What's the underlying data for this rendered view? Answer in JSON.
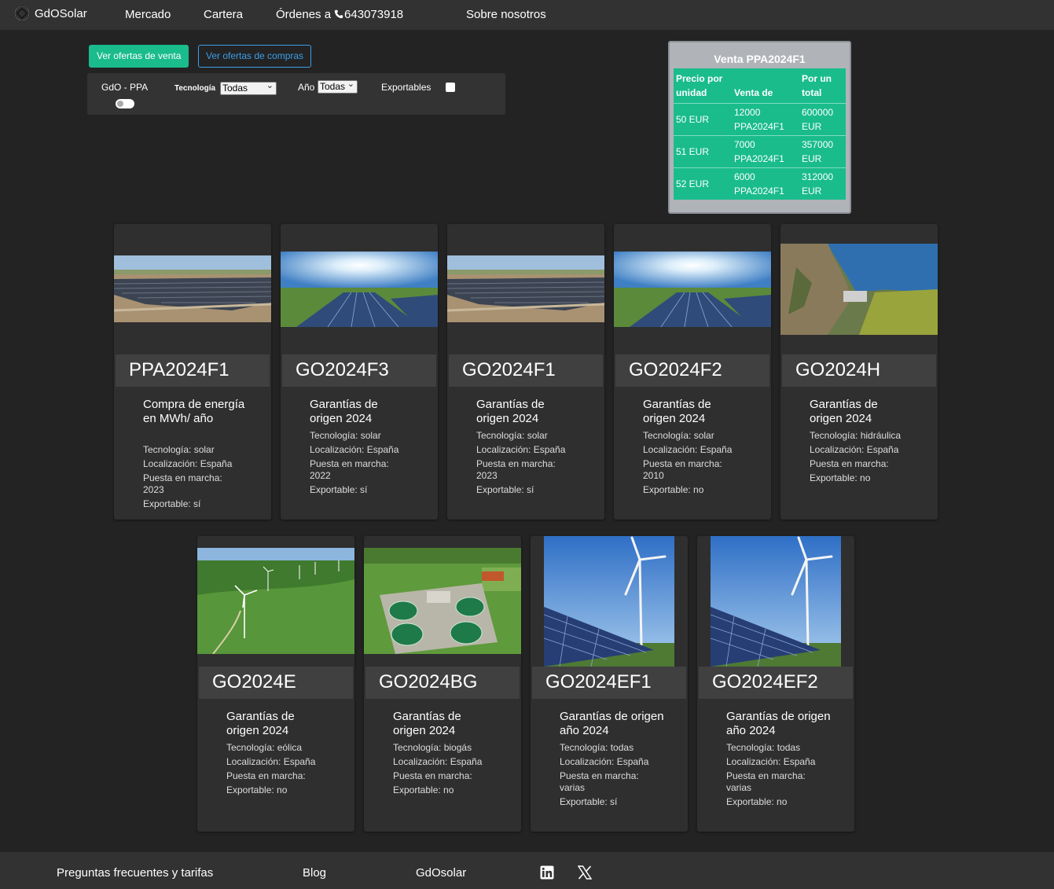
{
  "nav": {
    "brand": "GdOSolar",
    "links": [
      "Mercado",
      "Cartera",
      "Órdenes a",
      "643073918",
      "Sobre nosotros"
    ]
  },
  "buttons": {
    "sale": "Ver ofertas de venta",
    "buy": "Ver ofertas de compras"
  },
  "filters": {
    "gdo_ppa": "GdO - PPA",
    "tech_label": "Tecnología",
    "tech_value": "Todas",
    "year_label": "Año",
    "year_value": "Todas",
    "export_label": "Exportables",
    "gdo_ppa_toggle_on": false,
    "exportables_checked": false
  },
  "sale_panel": {
    "title": "Venta PPA2024F1",
    "headers": [
      "Precio por unidad",
      "Venta de",
      "Por un total"
    ],
    "rows": [
      [
        "50 EUR",
        "12000 PPA2024F1",
        "600000 EUR"
      ],
      [
        "51 EUR",
        "7000 PPA2024F1",
        "357000 EUR"
      ],
      [
        "52 EUR",
        "6000 PPA2024F1",
        "312000 EUR"
      ]
    ]
  },
  "cards": [
    {
      "title": "PPA2024F1",
      "desc": "Compra de energía en MWh/ año",
      "tech": "Tecnología: solar",
      "loc": "Localización: España",
      "start": "Puesta en marcha: 2023",
      "exp": "Exportable: sí"
    },
    {
      "title": "GO2024F3",
      "desc": "Garantías de origen 2024",
      "tech": "Tecnología: solar",
      "loc": "Localización: España",
      "start": "Puesta en marcha: 2022",
      "exp": "Exportable: sí"
    },
    {
      "title": "GO2024F1",
      "desc": "Garantías de origen 2024",
      "tech": "Tecnología: solar",
      "loc": "Localización: España",
      "start": "Puesta en marcha: 2023",
      "exp": "Exportable: sí"
    },
    {
      "title": "GO2024F2",
      "desc": "Garantías de origen 2024",
      "tech": "Tecnología: solar",
      "loc": "Localización: España",
      "start": "Puesta en marcha: 2010",
      "exp": "Exportable: no"
    },
    {
      "title": "GO2024H",
      "desc": "Garantías de origen 2024",
      "tech": "Tecnología: hidráulica",
      "loc": "Localización: España",
      "start": "Puesta en marcha:",
      "exp": "Exportable: no"
    },
    {
      "title": "GO2024E",
      "desc": "Garantías de origen 2024",
      "tech": "Tecnología: eólica",
      "loc": "Localización: España",
      "start": "Puesta en marcha:",
      "exp": "Exportable: no"
    },
    {
      "title": "GO2024BG",
      "desc": "Garantías de origen 2024",
      "tech": "Tecnología: biogás",
      "loc": "Localización: España",
      "start": "Puesta en marcha:",
      "exp": "Exportable: no"
    },
    {
      "title": "GO2024EF1",
      "desc": "Garantías de origen año 2024",
      "tech": "Tecnología: todas",
      "loc": "Localización: España",
      "start": "Puesta en marcha: varias",
      "exp": "Exportable: sí"
    },
    {
      "title": "GO2024EF2",
      "desc": "Garantías de origen año 2024",
      "tech": "Tecnología: todas",
      "loc": "Localización: España",
      "start": "Puesta en marcha: varias",
      "exp": "Exportable: no"
    }
  ],
  "footer": {
    "faq": "Preguntas frecuentes y tarifas",
    "blog": "Blog",
    "brand": "GdOsolar",
    "icons": [
      "linkedin-icon",
      "x-icon"
    ]
  },
  "colors": {
    "accent": "#1abc8c",
    "link_blue": "#3d9ee8",
    "background": "#232323",
    "navbar": "#323232"
  }
}
